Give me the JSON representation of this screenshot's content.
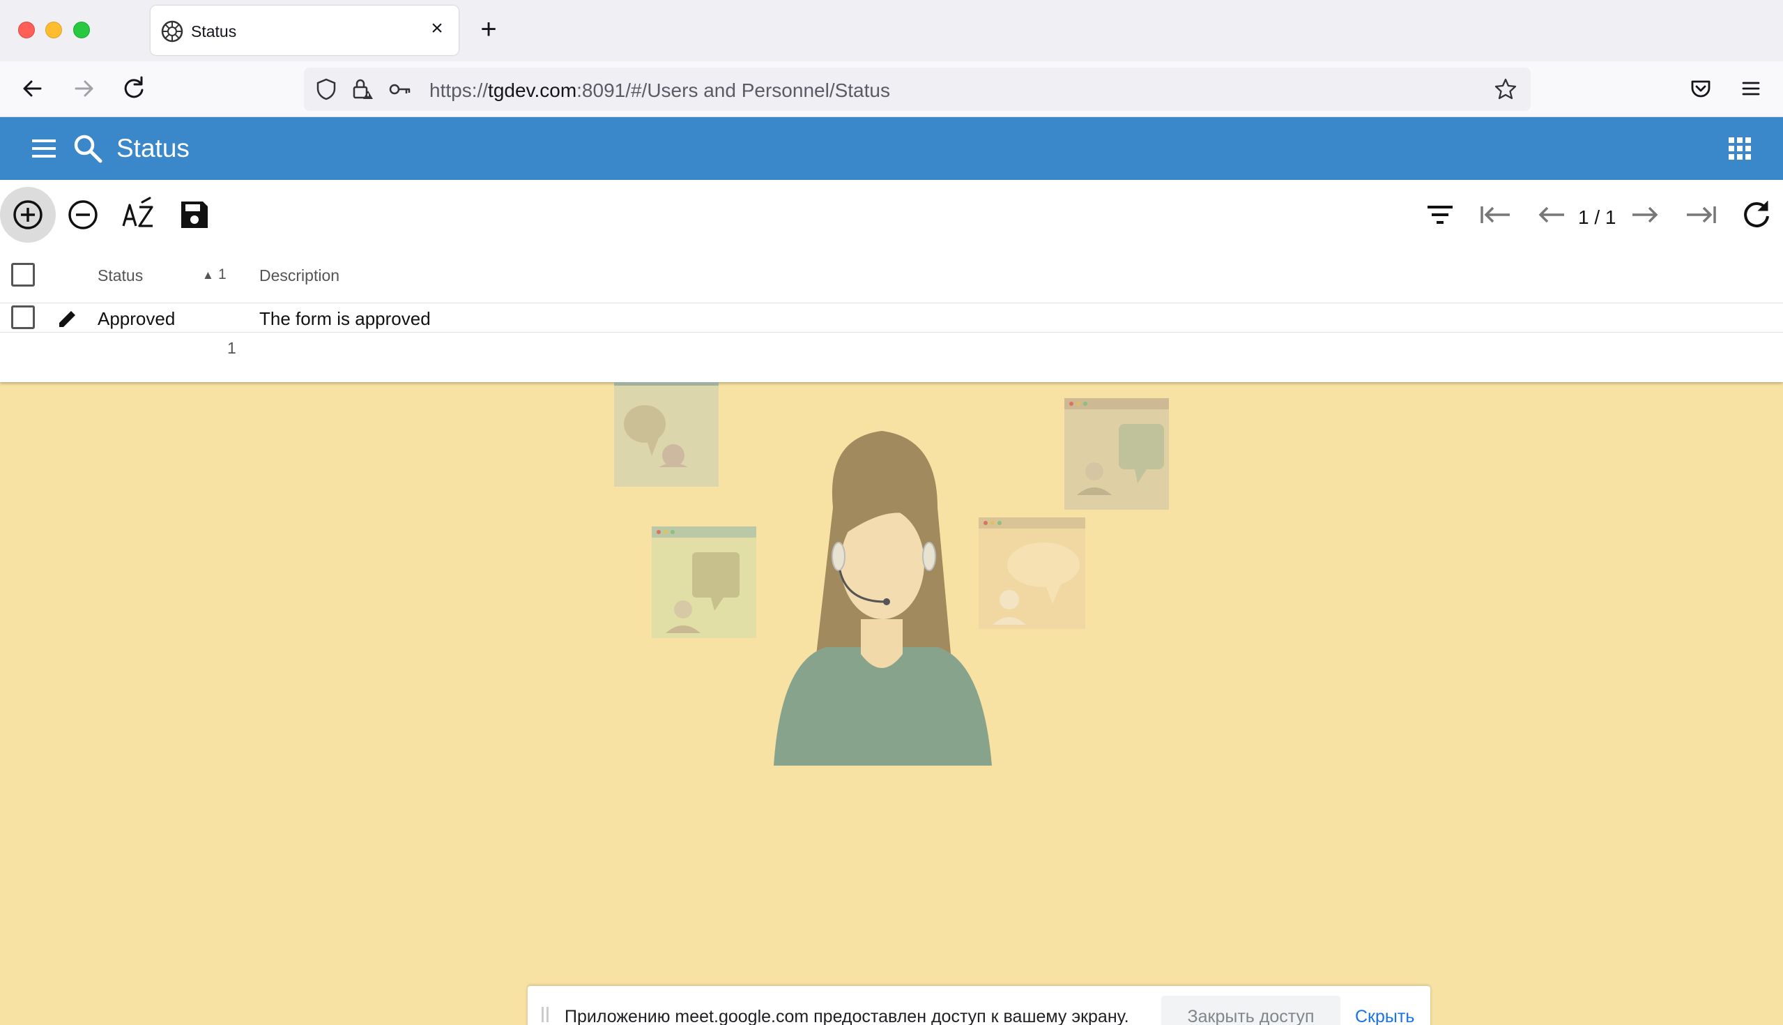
{
  "browser": {
    "tab_title": "Status",
    "url_scheme": "https://",
    "url_host": "tgdev.com",
    "url_rest": ":8091/#/Users and Personnel/Status"
  },
  "app": {
    "title": "Status",
    "accent_color": "#3a87c9"
  },
  "toolbar": {
    "pager_text": "1 / 1"
  },
  "grid": {
    "columns": {
      "status": "Status",
      "sort_indicator": "1",
      "description": "Description"
    },
    "rows": [
      {
        "status": "Approved",
        "description": "The form is approved"
      }
    ],
    "footer_count": "1"
  },
  "banner": {
    "message": "Приложению meet.google.com предоставлен доступ к вашему экрану.",
    "stop_label": "Закрыть доступ",
    "hide_label": "Скрыть"
  },
  "icons": {
    "browser": [
      "back-icon",
      "forward-icon",
      "reload-icon",
      "shield-icon",
      "lock-warning-icon",
      "key-icon",
      "star-icon",
      "pocket-icon",
      "menu-icon"
    ],
    "app": [
      "hamburger-icon",
      "search-icon",
      "apps-grid-icon"
    ],
    "toolbar": [
      "add-circle-icon",
      "remove-circle-icon",
      "sort-az-icon",
      "save-icon",
      "filter-icon",
      "first-page-icon",
      "prev-page-icon",
      "next-page-icon",
      "last-page-icon",
      "refresh-icon"
    ]
  }
}
